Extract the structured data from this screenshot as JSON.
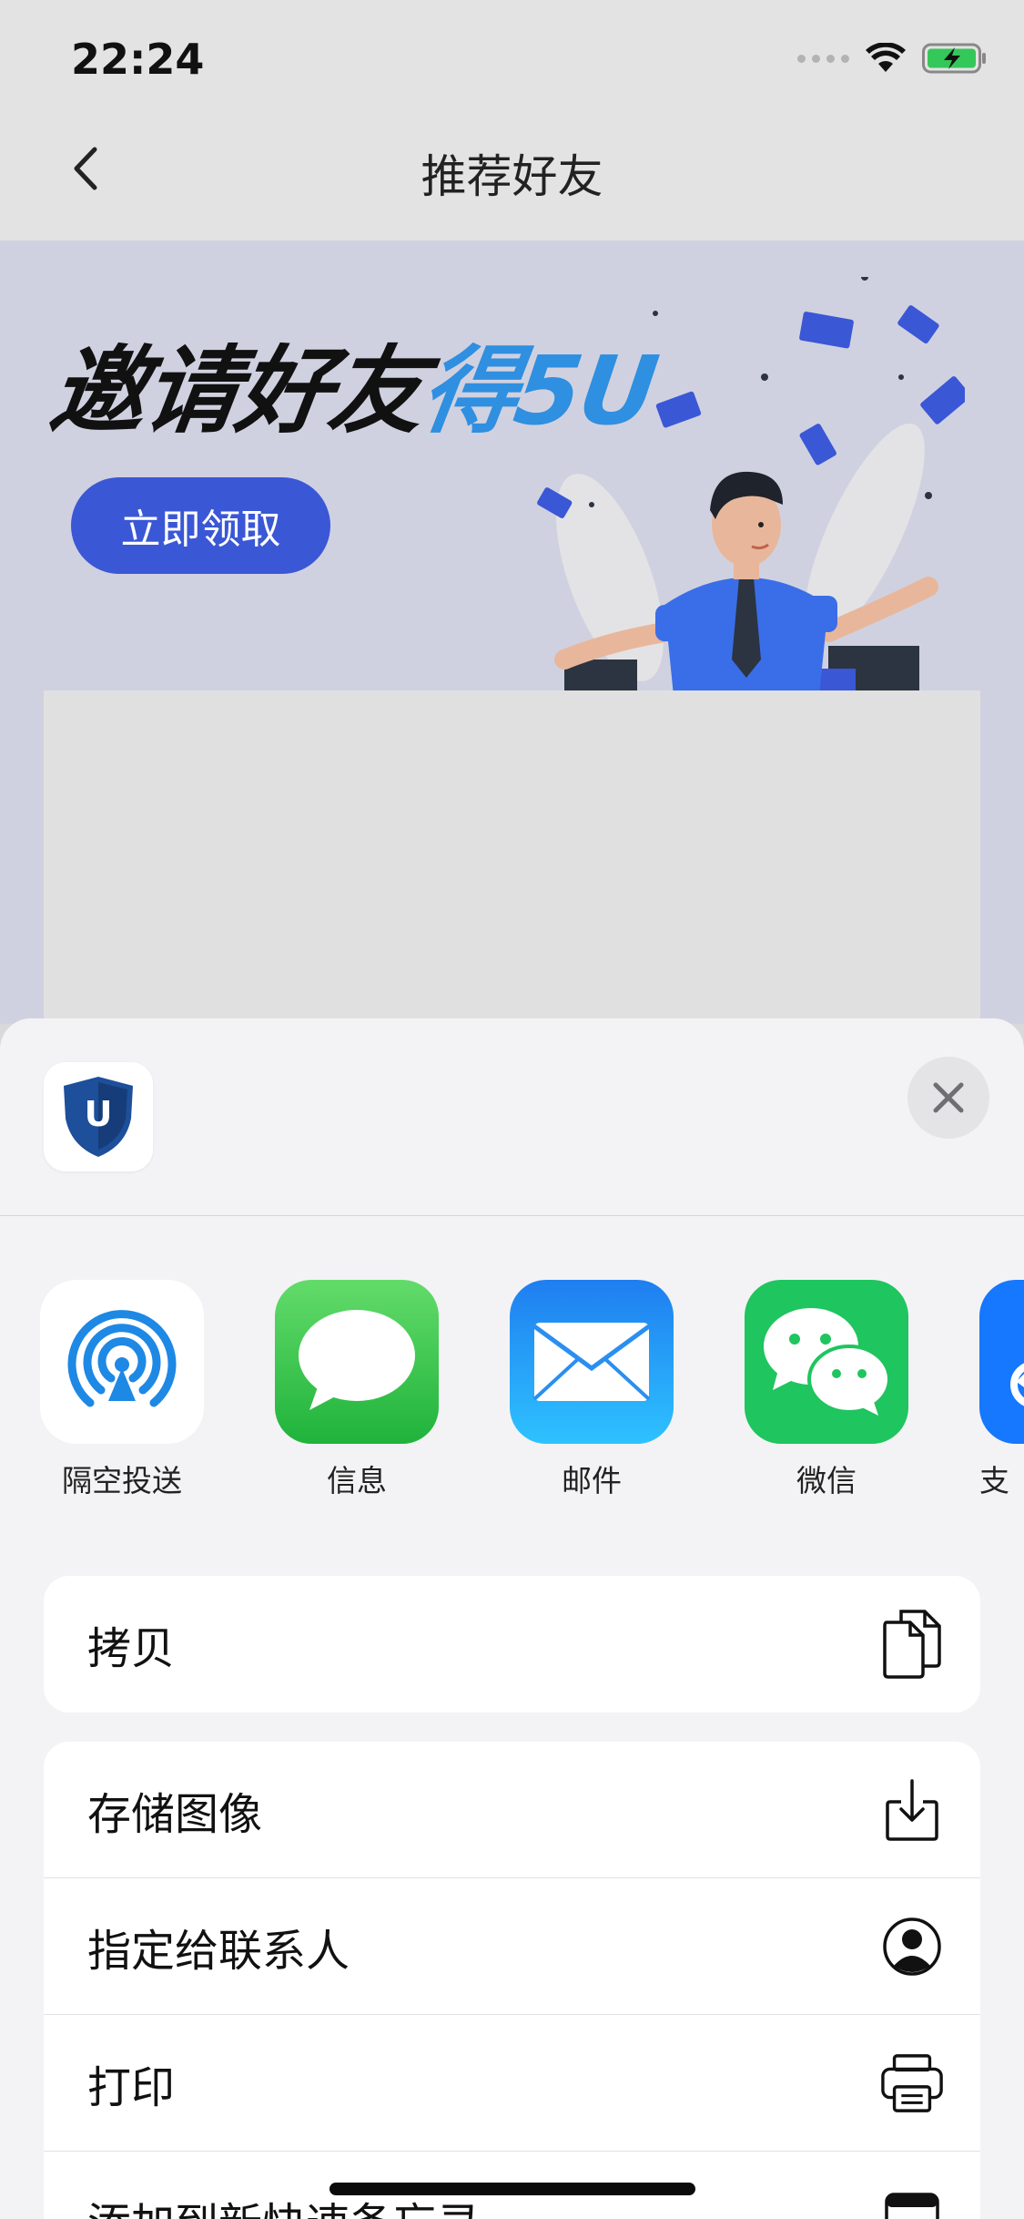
{
  "status_bar": {
    "time": "22:24"
  },
  "nav": {
    "title": "推荐好友"
  },
  "banner": {
    "title_black": "邀请好友",
    "title_blue": "得5U",
    "claim_button": "立即领取"
  },
  "share_sheet": {
    "app_thumb_letter": "U",
    "apps": [
      {
        "label": "隔空投送",
        "icon": "airdrop-icon"
      },
      {
        "label": "信息",
        "icon": "messages-icon"
      },
      {
        "label": "邮件",
        "icon": "mail-icon"
      },
      {
        "label": "微信",
        "icon": "wechat-icon"
      },
      {
        "label": "支",
        "icon": "alipay-icon"
      }
    ],
    "actions_group1": [
      {
        "label": "拷贝",
        "icon": "copy-icon"
      }
    ],
    "actions_group2": [
      {
        "label": "存储图像",
        "icon": "save-image-icon"
      },
      {
        "label": "指定给联系人",
        "icon": "assign-contact-icon"
      },
      {
        "label": "打印",
        "icon": "print-icon"
      },
      {
        "label": "添加到新快速备忘录",
        "icon": "quick-note-icon"
      }
    ]
  },
  "colors": {
    "accent_blue": "#3a57d6",
    "title_blue": "#2f8fe0",
    "banner_bg": "#d0d1e0"
  }
}
